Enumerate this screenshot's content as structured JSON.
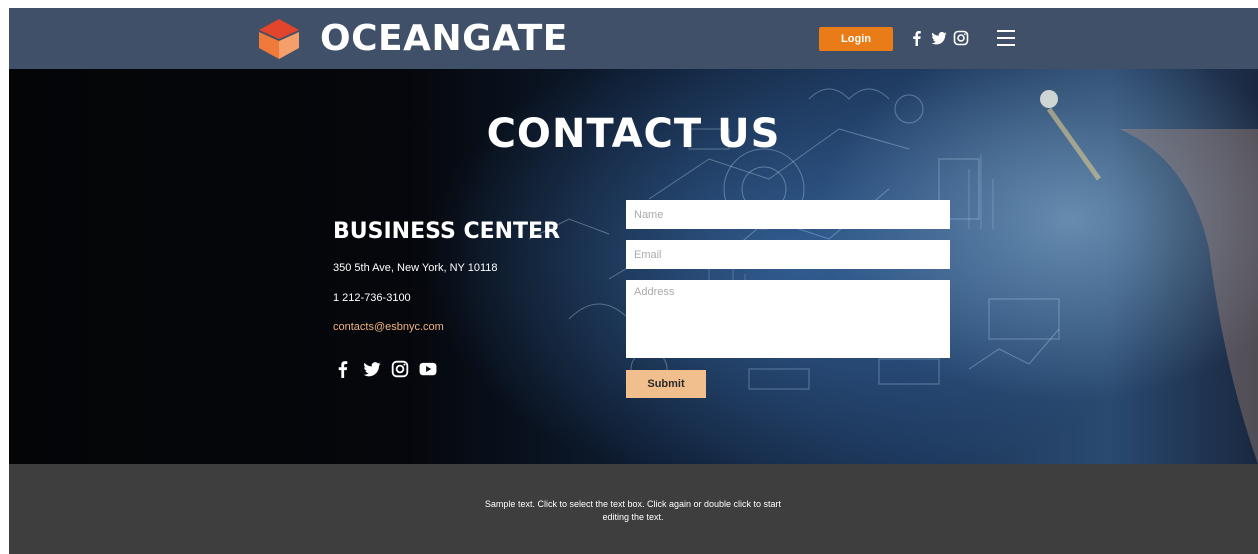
{
  "header": {
    "brand": "OCEANGATE",
    "login_label": "Login",
    "social_icons": [
      "facebook-icon",
      "twitter-icon",
      "instagram-icon"
    ],
    "menu_icon": "hamburger-menu-icon"
  },
  "hero": {
    "title": "CONTACT US"
  },
  "business": {
    "title": "BUSINESS CENTER",
    "address": "350 5th Ave, New York, NY 10118",
    "phone": "1 212-736-3100",
    "email": "contacts@esbnyc.com",
    "social_icons": [
      "facebook-icon",
      "twitter-icon",
      "instagram-icon",
      "youtube-icon"
    ]
  },
  "form": {
    "name_placeholder": "Name",
    "email_placeholder": "Email",
    "address_placeholder": "Address",
    "submit_label": "Submit"
  },
  "footer": {
    "text": "Sample text. Click to select the text box. Click again or double click to start editing the text."
  },
  "colors": {
    "header_bg": "#3f5068",
    "accent_orange": "#e97c16",
    "submit_bg": "#f1be8d",
    "email_link": "#f0b47e",
    "footer_bg": "#3e3e3e",
    "logo_red": "#e2452b",
    "logo_orange": "#f07a3a"
  }
}
